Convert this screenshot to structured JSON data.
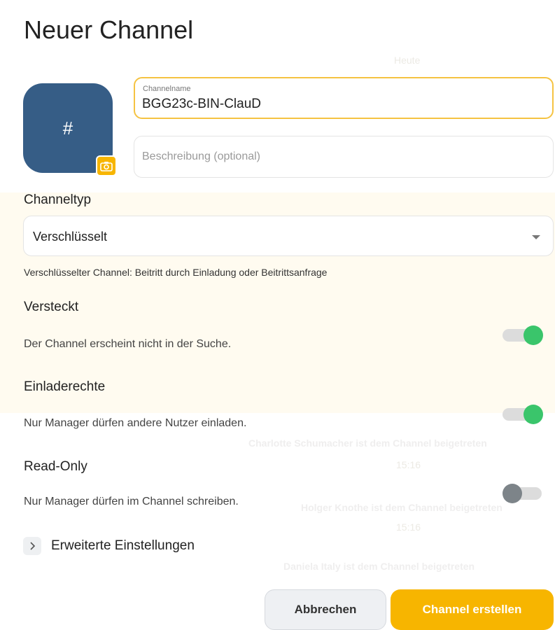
{
  "dialog": {
    "title": "Neuer Channel",
    "avatar_symbol": "#",
    "camera_icon": "camera-icon",
    "name_field": {
      "label": "Channelname",
      "value": "BGG23c-BIN-ClauD"
    },
    "description_field": {
      "placeholder": "Beschreibung (optional)"
    },
    "channel_type": {
      "label": "Channeltyp",
      "selected": "Verschlüsselt",
      "hint": "Verschlüsselter Channel: Beitritt durch Einladung oder Beitrittsanfrage"
    },
    "settings": [
      {
        "title": "Versteckt",
        "description": "Der Channel erscheint nicht in der Suche.",
        "enabled": true
      },
      {
        "title": "Einladerechte",
        "description": "Nur Manager dürfen andere Nutzer einladen.",
        "enabled": true
      },
      {
        "title": "Read-Only",
        "description": "Nur Manager dürfen im Channel schreiben.",
        "enabled": false
      }
    ],
    "advanced_label": "Erweiterte Einstellungen",
    "cancel_label": "Abbrechen",
    "create_label": "Channel erstellen"
  },
  "colors": {
    "accent": "#f7b500",
    "avatar": "#365d86",
    "toggle_on": "#3ac56b",
    "toggle_off": "#7d8489"
  },
  "background_chat": {
    "day_label": "Heute",
    "joined_1": "Charlotte Schumacher ist dem Channel beigetreten",
    "time_1": "15:16",
    "joined_2": "Holger Knothe ist dem Channel beigetreten",
    "time_2": "15:16",
    "joined_3": "Daniela Italy ist dem Channel beigetreten"
  }
}
